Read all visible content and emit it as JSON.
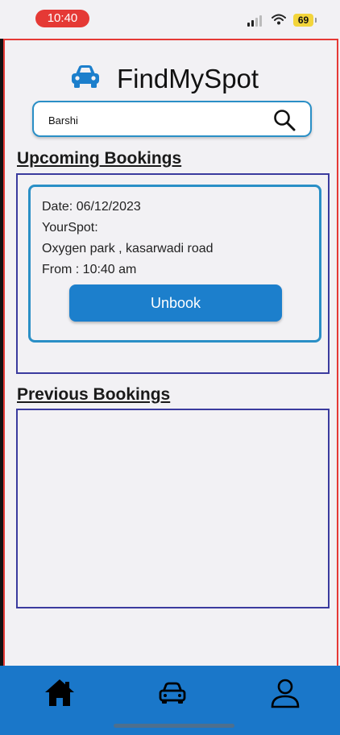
{
  "status_bar": {
    "time": "10:40",
    "battery": "69",
    "time_pill_color": "#e53935",
    "battery_color": "#f3d53b",
    "icons": [
      "signal-icon",
      "wifi-icon",
      "battery-icon"
    ]
  },
  "header": {
    "app_title": "FindMySpot",
    "logo_icon": "car-icon",
    "logo_color": "#1c7fcc"
  },
  "search": {
    "value": "Barshi",
    "icon": "search-icon",
    "border_color": "#2a8fc6"
  },
  "upcoming": {
    "title": "Upcoming Bookings",
    "booking": {
      "date_line": "Date: 06/12/2023",
      "spot_label": "YourSpot:",
      "spot_name": "Oxygen park , kasarwadi road",
      "from_line": "From : 10:40 am",
      "unbook_label": "Unbook"
    }
  },
  "previous": {
    "title": "Previous Bookings"
  },
  "bottom_nav": {
    "background": "#1a77c9",
    "items": [
      {
        "icon": "home-icon"
      },
      {
        "icon": "car-icon"
      },
      {
        "icon": "profile-icon"
      }
    ]
  }
}
